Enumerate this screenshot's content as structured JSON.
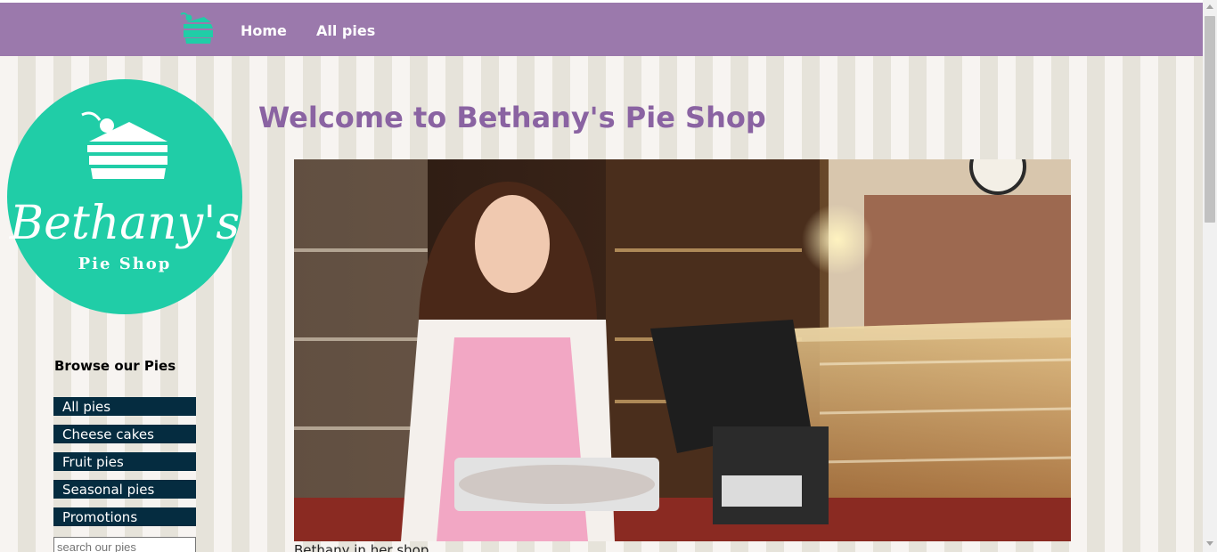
{
  "navbar": {
    "logo_icon": "pie-slice-icon",
    "links": [
      "Home",
      "All pies"
    ]
  },
  "logo": {
    "name": "Bethany's",
    "tagline": "Pie Shop",
    "icon": "cake-slice-icon",
    "color": "#20cda7"
  },
  "sidebar": {
    "heading": "Browse our Pies",
    "categories": [
      "All pies",
      "Cheese cakes",
      "Fruit pies",
      "Seasonal pies",
      "Promotions"
    ],
    "search_placeholder": "search our pies"
  },
  "main": {
    "title": "Welcome to Bethany's Pie Shop",
    "hero_caption": "Bethany in her shop"
  },
  "colors": {
    "nav_bg": "#9b79ac",
    "title": "#8a63a2",
    "category_bg": "#052c40"
  }
}
